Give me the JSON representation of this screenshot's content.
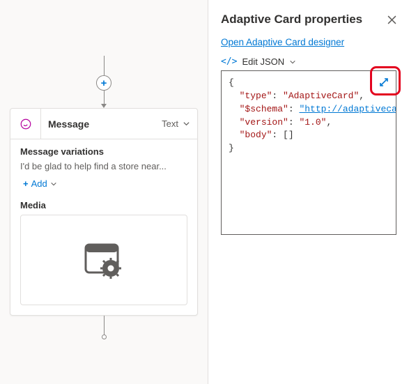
{
  "canvas": {
    "plus_label": "+",
    "node": {
      "title": "Message",
      "type_label": "Text",
      "variations_heading": "Message variations",
      "variation_preview": "I'd be glad to help find a store near...",
      "add_label": "Add",
      "media_heading": "Media"
    }
  },
  "panel": {
    "title": "Adaptive Card properties",
    "designer_link_label": "Open Adaptive Card designer",
    "edit_json_label": "Edit JSON",
    "json": {
      "type_key": "\"type\"",
      "type_value": "\"AdaptiveCard\"",
      "schema_key": "\"$schema\"",
      "schema_value": "\"http://adaptivecards.i",
      "version_key": "\"version\"",
      "version_value": "\"1.0\"",
      "body_key": "\"body\"",
      "body_value": "[]"
    }
  }
}
